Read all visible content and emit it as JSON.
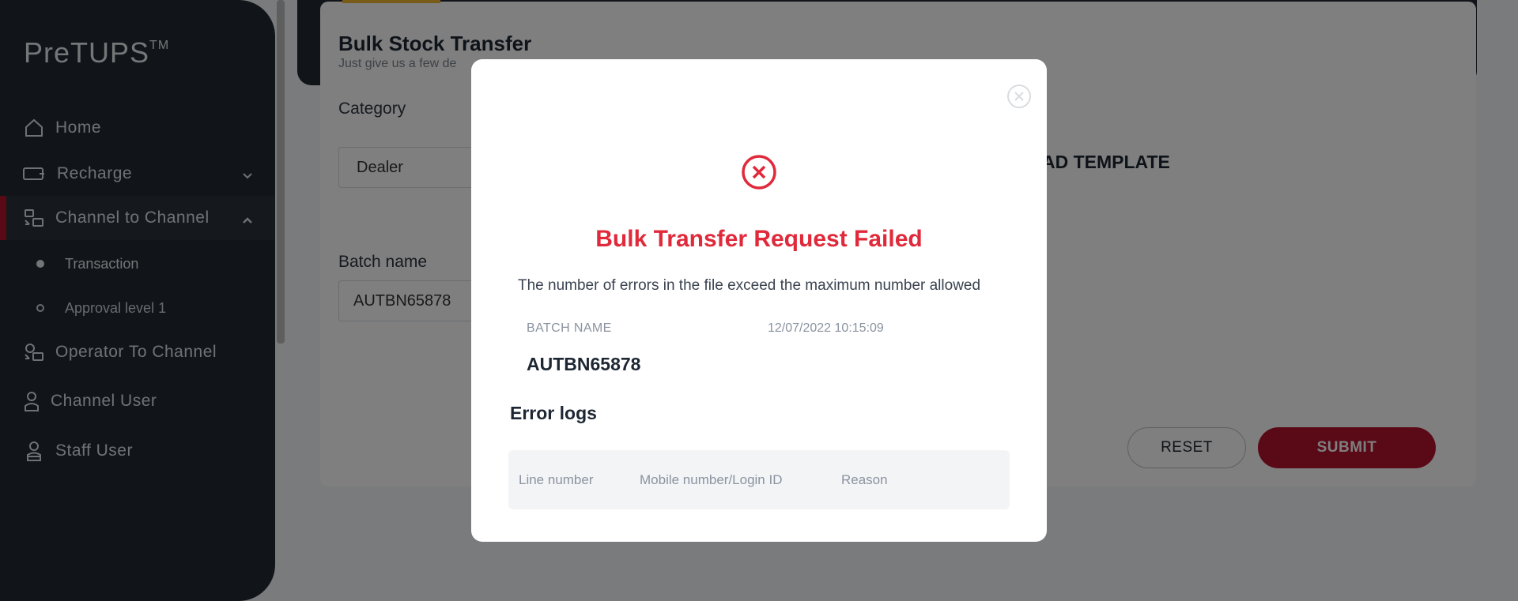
{
  "sidebar": {
    "logo": "PreTUPS",
    "logo_tm": "TM",
    "items": [
      {
        "label": "Home",
        "icon": "home-icon"
      },
      {
        "label": "Recharge",
        "icon": "recharge-icon"
      },
      {
        "label": "Channel to Channel",
        "icon": "channel-transfer-icon"
      },
      {
        "label": "Operator To Channel",
        "icon": "operator-transfer-icon"
      },
      {
        "label": "Channel User",
        "icon": "user-icon"
      },
      {
        "label": "Staff User",
        "icon": "staff-icon"
      }
    ],
    "sub_items": [
      {
        "label": "Transaction"
      },
      {
        "label": "Approval level 1"
      }
    ]
  },
  "page": {
    "title": "Bulk Stock Transfer",
    "subtitle": "Just give us a few de",
    "category_label": "Category",
    "category_value": "Dealer",
    "batch_label": "Batch name",
    "batch_value": "AUTBN65878",
    "template_link": "AD TEMPLATE",
    "reset_label": "RESET",
    "submit_label": "SUBMIT"
  },
  "modal": {
    "title": "Bulk Transfer Request Failed",
    "message": "The number of errors in the file exceed the maximum number allowed",
    "batch_name_label": "BATCH NAME",
    "timestamp": "12/07/2022 10:15:09",
    "batch_name_value": "AUTBN65878",
    "error_logs_title": "Error logs",
    "columns": [
      "Line number",
      "Mobile number/Login ID",
      "Reason"
    ]
  },
  "colors": {
    "sidebar_bg": "#222a33",
    "accent_red": "#b5122e",
    "error_red": "#e0293a",
    "tab_accent": "#f2b632"
  }
}
